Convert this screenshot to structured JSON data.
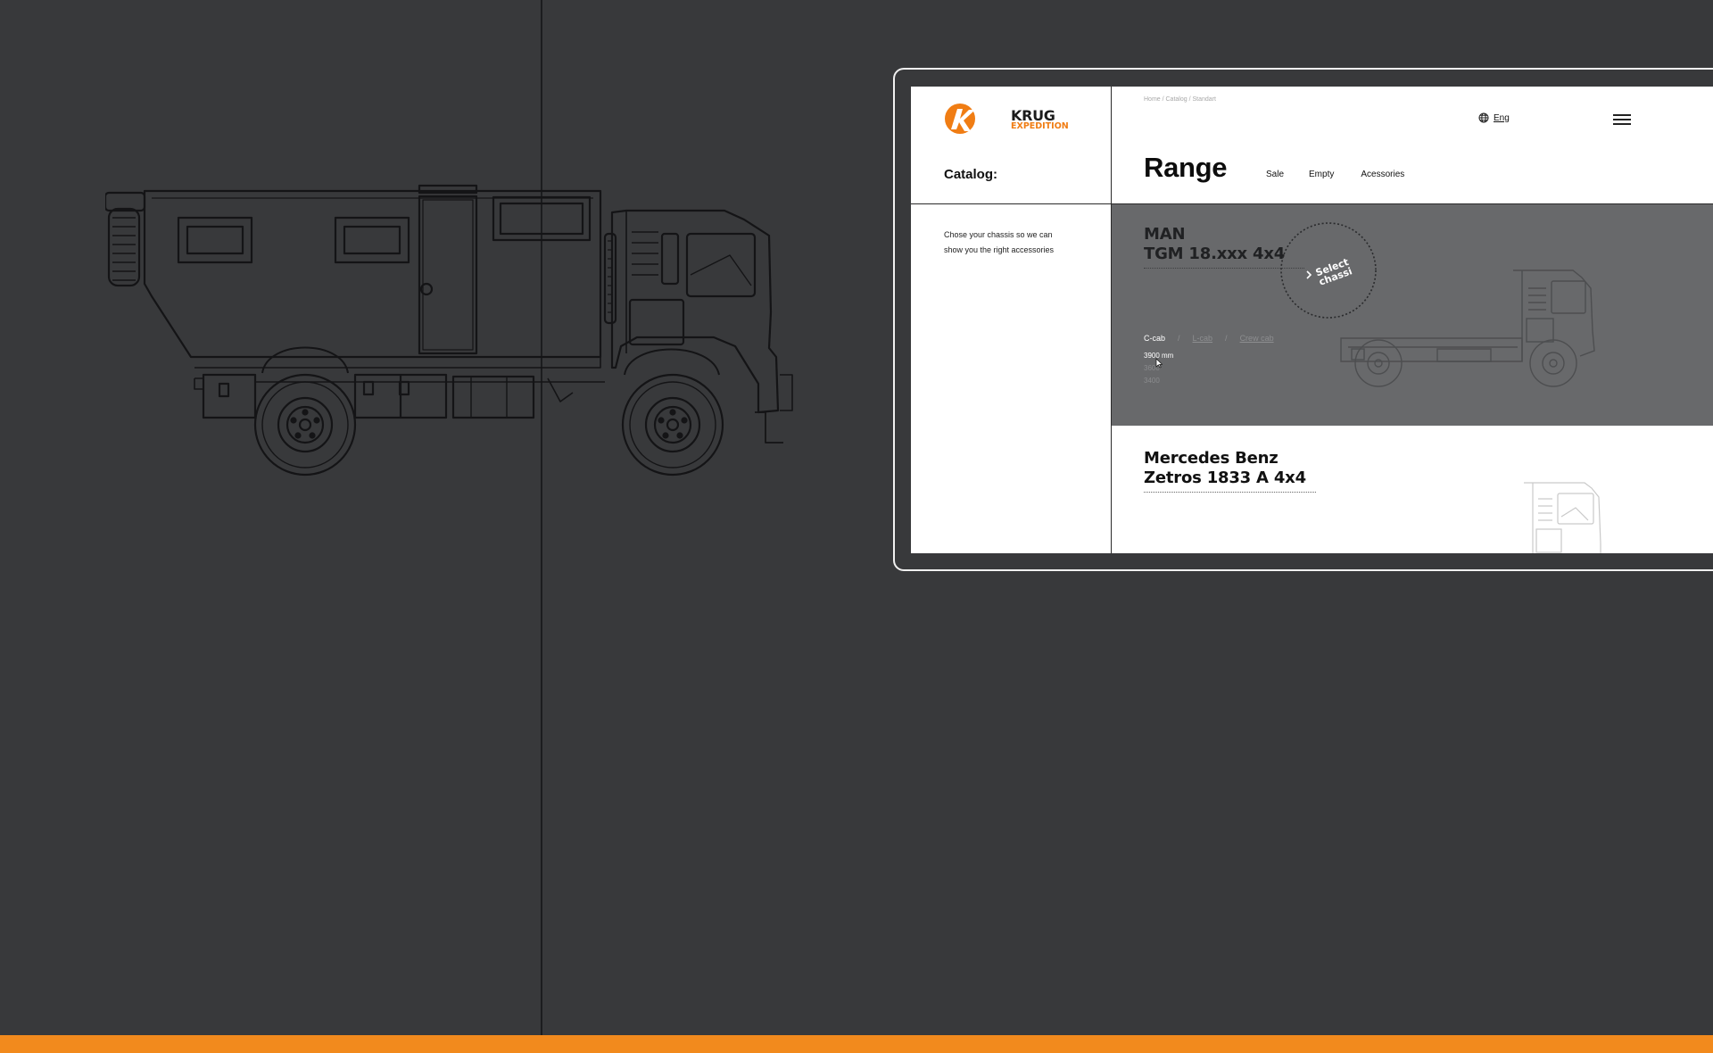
{
  "brand": {
    "name": "KRUG",
    "sub": "EXPEDITION",
    "accent": "#f07d14"
  },
  "sidebar": {
    "catalog_title": "Catalog:",
    "intro_line1": "Chose your chassis so we can",
    "intro_line2": "show you the right accessories"
  },
  "header": {
    "breadcrumb": "Home / Catalog / Standart",
    "language": "Eng",
    "page_title": "Range",
    "tabs": [
      {
        "label": "Sale"
      },
      {
        "label": "Empty"
      },
      {
        "label": "Acessories"
      }
    ]
  },
  "cards": [
    {
      "title_line1": "MAN",
      "title_line2": "TGM 18.xxx 4x4",
      "select_label_1": "Select",
      "select_label_2": "chassi",
      "cab_options": [
        {
          "label": "C-cab",
          "active": true
        },
        {
          "label": "L-cab",
          "active": false
        },
        {
          "label": "Crew cab",
          "active": false
        }
      ],
      "cab_separator": "/",
      "wheelbases": [
        {
          "label": "3900 mm",
          "active": true
        },
        {
          "label": "3600",
          "active": false
        },
        {
          "label": "3400",
          "active": false
        }
      ]
    },
    {
      "title_line1": "Mercedes Benz",
      "title_line2": "Zetros 1833 A 4x4"
    }
  ],
  "colors": {
    "background": "#38393b",
    "accent_bar": "#f28a1d",
    "card_active_bg": "#68696b"
  },
  "icons": [
    "krug-logo-icon",
    "globe-icon",
    "menu-icon",
    "chevron-right-icon",
    "cursor-icon"
  ]
}
